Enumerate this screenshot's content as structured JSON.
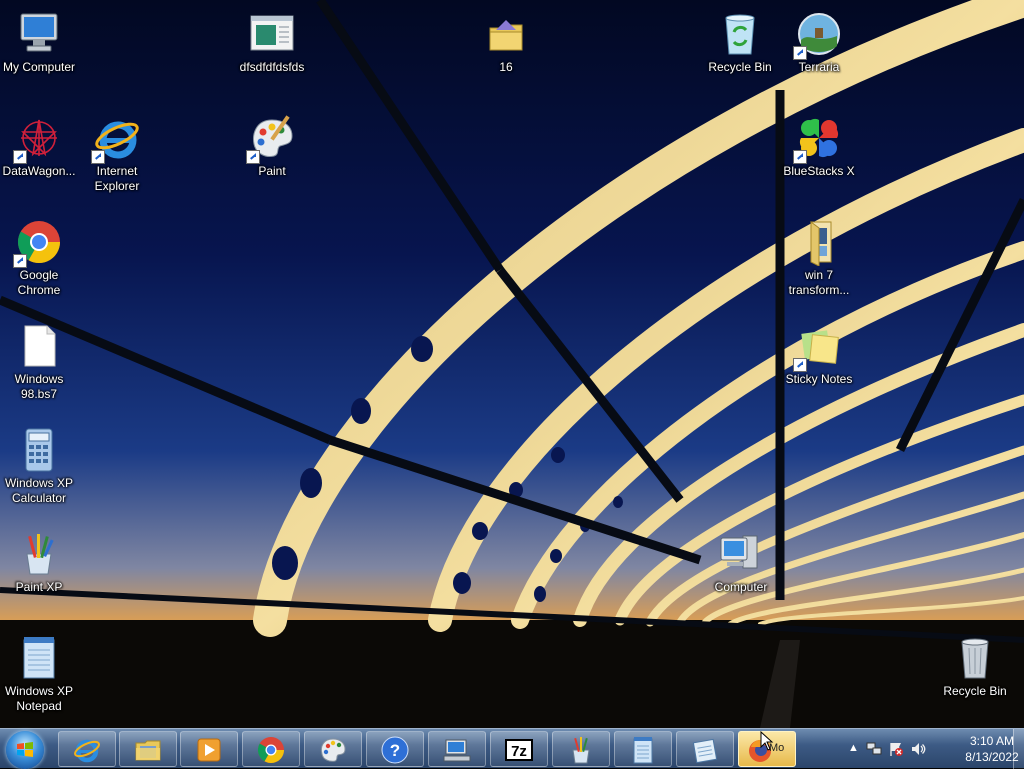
{
  "desktop": {
    "icons": {
      "my_computer": "My Computer",
      "dfsd": "dfsdfdfdsfds",
      "folder16": "16",
      "recycle_full": "Recycle Bin",
      "terraria": "Terraria",
      "datawagon": "DataWagon...",
      "ie": "Internet\nExplorer",
      "paint": "Paint",
      "bluestacks": "BlueStacks X",
      "chrome": "Google\nChrome",
      "win7": "win 7\ntransform...",
      "win98": "Windows\n98.bs7",
      "sticky": "Sticky Notes",
      "xpcalc": "Windows XP\nCalculator",
      "paintxp": "Paint XP",
      "computer": "Computer",
      "notepad": "Windows XP\nNotepad",
      "recycle_empty": "Recycle Bin"
    }
  },
  "taskbar": {
    "active_label": "Mo",
    "clock": {
      "time": "3:10 AM",
      "date": "8/13/2022"
    }
  },
  "colors": {
    "accent": "#3d5b85",
    "sky_top": "#020a35",
    "sky_bottom": "#e6a54a"
  }
}
